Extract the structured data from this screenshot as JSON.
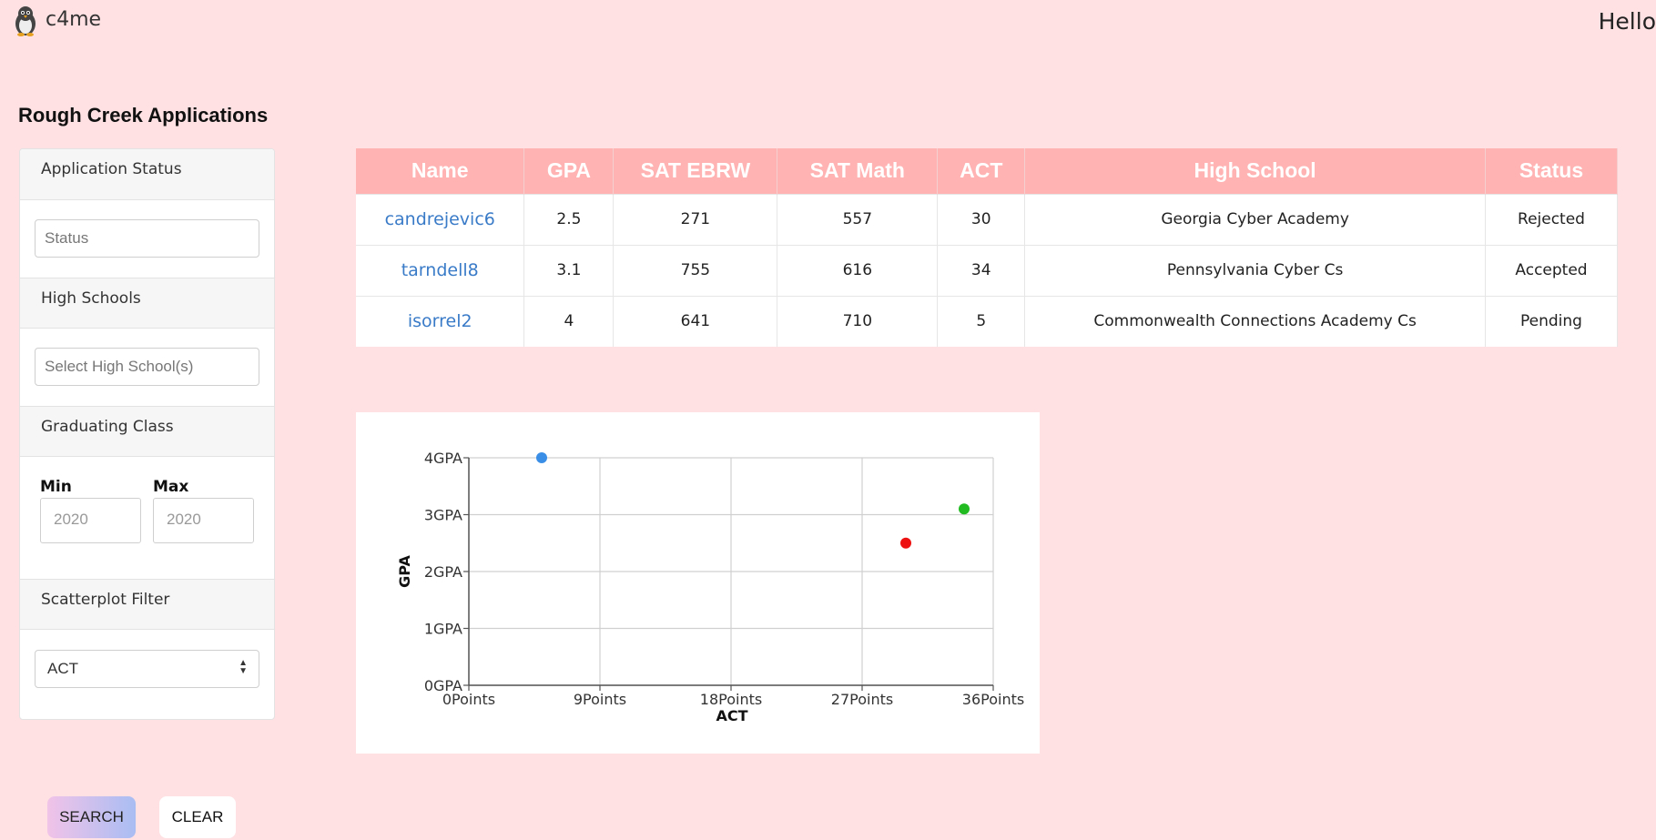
{
  "header": {
    "brand": "c4me",
    "greeting": "Hello"
  },
  "page_title": "Rough Creek Applications",
  "sidebar": {
    "status": {
      "heading": "Application Status",
      "placeholder": "Status"
    },
    "high_schools": {
      "heading": "High Schools",
      "placeholder": "Select High School(s)"
    },
    "graduating_class": {
      "heading": "Graduating Class",
      "min_label": "Min",
      "max_label": "Max",
      "min_value": "2020",
      "max_value": "2020"
    },
    "scatter_filter": {
      "heading": "Scatterplot Filter",
      "selected": "ACT"
    }
  },
  "buttons": {
    "search": "SEARCH",
    "clear": "CLEAR"
  },
  "table": {
    "columns": [
      "Name",
      "GPA",
      "SAT EBRW",
      "SAT Math",
      "ACT",
      "High School",
      "Status"
    ],
    "rows": [
      [
        "candrejevic6",
        "2.5",
        "271",
        "557",
        "30",
        "Georgia Cyber Academy",
        "Rejected"
      ],
      [
        "tarndell8",
        "3.1",
        "755",
        "616",
        "34",
        "Pennsylvania Cyber Cs",
        "Accepted"
      ],
      [
        "isorrel2",
        "4",
        "641",
        "710",
        "5",
        "Commonwealth Connections Academy Cs",
        "Pending"
      ]
    ]
  },
  "chart_data": {
    "type": "scatter",
    "xlabel": "ACT",
    "ylabel": "GPA",
    "xlim": [
      0,
      36
    ],
    "ylim": [
      0,
      4
    ],
    "x_ticks": [
      "0Points",
      "9Points",
      "18Points",
      "27Points",
      "36Points"
    ],
    "y_ticks": [
      "0GPA",
      "1GPA",
      "2GPA",
      "3GPA",
      "4GPA"
    ],
    "grid": true,
    "points": [
      {
        "x": 30,
        "y": 2.5,
        "color": "#ee1111"
      },
      {
        "x": 34,
        "y": 3.1,
        "color": "#22bb22"
      },
      {
        "x": 5,
        "y": 4,
        "color": "#3a8ee6"
      }
    ]
  }
}
